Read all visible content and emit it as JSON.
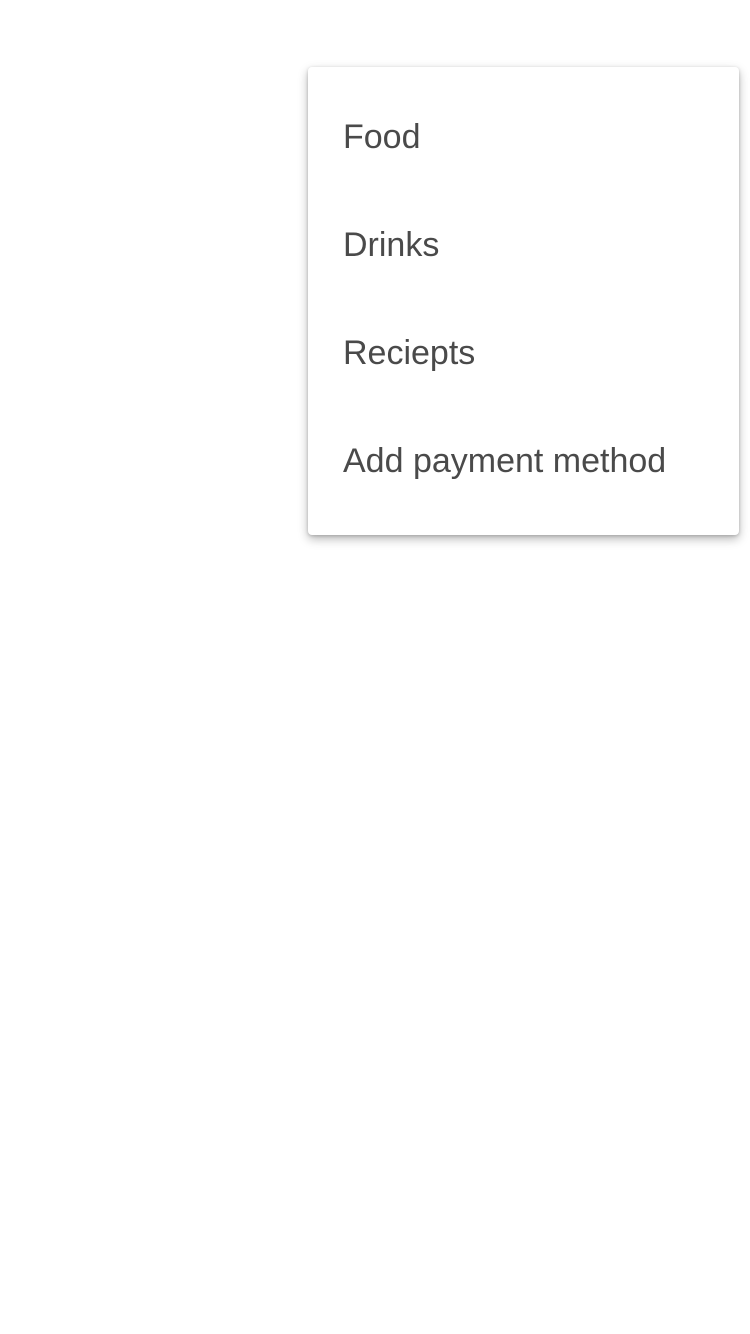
{
  "menu": {
    "items": [
      {
        "label": "Food"
      },
      {
        "label": "Drinks"
      },
      {
        "label": "Reciepts"
      },
      {
        "label": "Add payment method"
      }
    ]
  }
}
